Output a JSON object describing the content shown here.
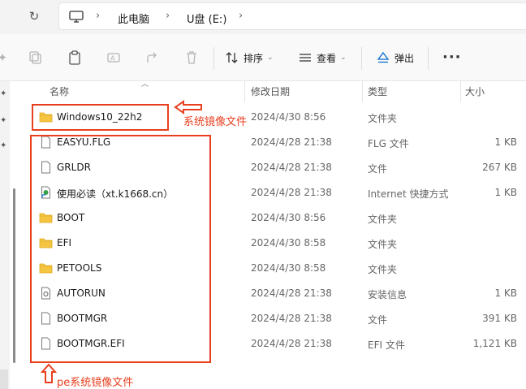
{
  "address_bar": {
    "crumbs": [
      "此电脑",
      "U盘 (E:)"
    ]
  },
  "toolbar": {
    "sort_label": "排序",
    "view_label": "查看",
    "eject_label": "弹出",
    "more_label": "···"
  },
  "columns": {
    "name": "名称",
    "modified": "修改日期",
    "type": "类型",
    "size": "大小"
  },
  "files": [
    {
      "name": "Windows10_22h2",
      "modified": "2024/4/30 8:56",
      "type": "文件夹",
      "size": "",
      "icon": "folder-icon"
    },
    {
      "name": "EASYU.FLG",
      "modified": "2024/4/28 21:38",
      "type": "FLG 文件",
      "size": "1 KB",
      "icon": "file-icon"
    },
    {
      "name": "GRLDR",
      "modified": "2024/4/28 21:38",
      "type": "文件",
      "size": "267 KB",
      "icon": "file-icon"
    },
    {
      "name": "使用必读（xt.k1668.cn）",
      "modified": "2024/4/28 21:38",
      "type": "Internet 快捷方式",
      "size": "1 KB",
      "icon": "shortcut-icon"
    },
    {
      "name": "BOOT",
      "modified": "2024/4/30 8:56",
      "type": "文件夹",
      "size": "",
      "icon": "folder-icon"
    },
    {
      "name": "EFI",
      "modified": "2024/4/30 8:58",
      "type": "文件夹",
      "size": "",
      "icon": "folder-icon"
    },
    {
      "name": "PETOOLS",
      "modified": "2024/4/30 8:58",
      "type": "文件夹",
      "size": "",
      "icon": "folder-icon"
    },
    {
      "name": "AUTORUN",
      "modified": "2024/4/28 21:38",
      "type": "安装信息",
      "size": "1 KB",
      "icon": "settings-file-icon"
    },
    {
      "name": "BOOTMGR",
      "modified": "2024/4/28 21:38",
      "type": "文件",
      "size": "391 KB",
      "icon": "file-icon"
    },
    {
      "name": "BOOTMGR.EFI",
      "modified": "2024/4/28 21:38",
      "type": "EFI 文件",
      "size": "1,121 KB",
      "icon": "file-icon"
    }
  ],
  "annotations": {
    "system_image": "系统镜像文件",
    "pe_image": "pe系统镜像文件"
  },
  "colors": {
    "annotation": "#e8401f",
    "folder": "#f5c542",
    "eject_accent": "#0a6ccf"
  }
}
